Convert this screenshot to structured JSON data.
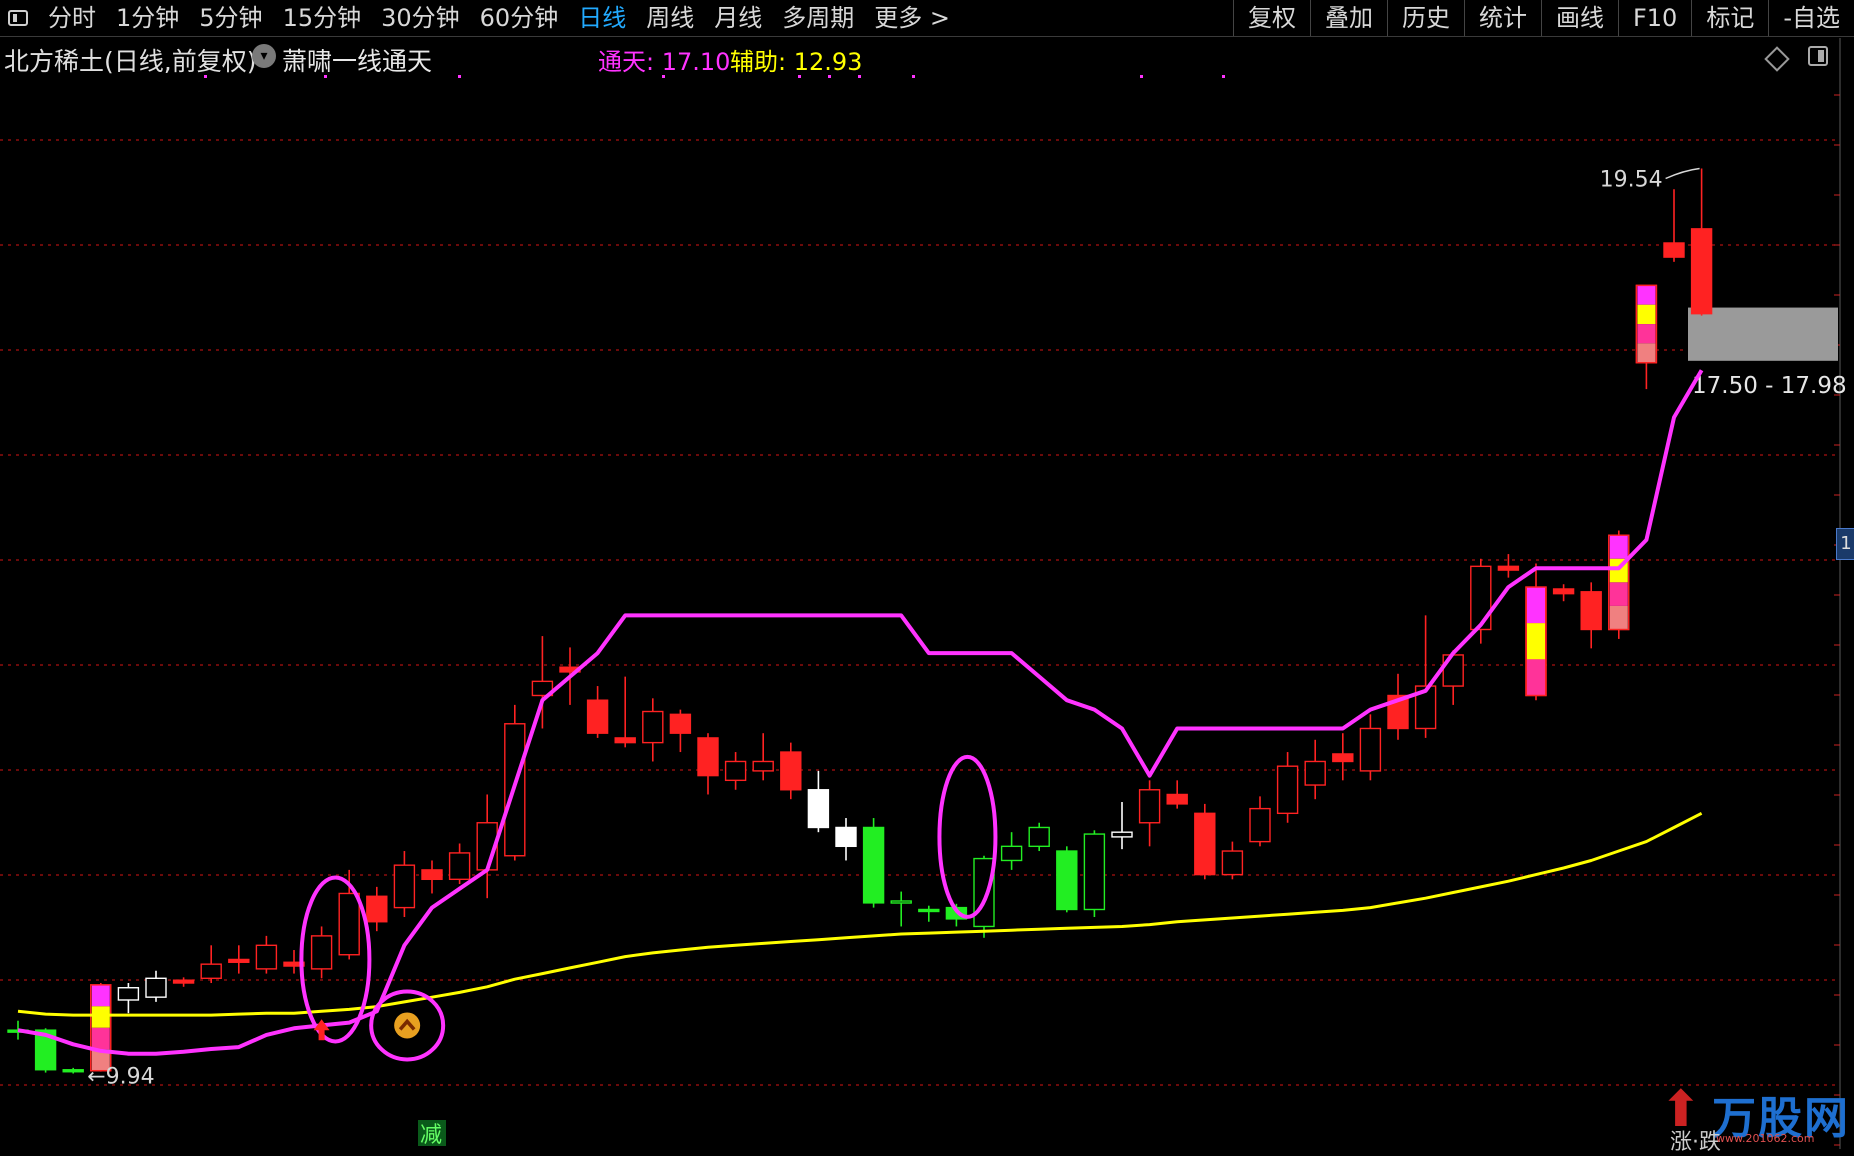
{
  "toolbar": {
    "periods": [
      "分时",
      "1分钟",
      "5分钟",
      "15分钟",
      "30分钟",
      "60分钟",
      "日线",
      "周线",
      "月线",
      "多周期",
      "更多 >"
    ],
    "active_index": 6,
    "right_buttons": [
      "复权",
      "叠加",
      "历史",
      "统计",
      "画线",
      "F10",
      "标记",
      "-自选"
    ]
  },
  "info": {
    "stock_title": "北方稀土(日线,前复权)",
    "indicator_name": "萧啸一线通天",
    "tongtian_label": "通天: 17.10",
    "fuzhu_label": "辅助: 12.93"
  },
  "side_tab": "1",
  "watermark": {
    "brand": "万股网",
    "url": "www.201062.com",
    "sub": "涨·跌"
  },
  "colors": {
    "up": "#ff2222",
    "down": "#22ee22",
    "tongtian": "#ff33ff",
    "fuzhu": "#ffff00",
    "grid": "#aa1111"
  },
  "chart_data": {
    "type": "candlestick",
    "price_range": [
      9.5,
      20.5
    ],
    "annotations": {
      "high_label": "19.54",
      "low_label": "9.94",
      "zone_label": "17.50 - 17.98",
      "sell_marker": "减"
    },
    "zone": [
      17.5,
      17.98
    ],
    "candles": [
      {
        "o": 10.4,
        "h": 10.5,
        "l": 10.3,
        "c": 10.4,
        "t": "d"
      },
      {
        "o": 10.4,
        "h": 10.42,
        "l": 9.95,
        "c": 9.98,
        "t": "d"
      },
      {
        "o": 9.98,
        "h": 10.0,
        "l": 9.94,
        "c": 9.97,
        "t": "d"
      },
      {
        "o": 9.97,
        "h": 10.9,
        "l": 9.96,
        "c": 10.88,
        "t": "u",
        "bars": true
      },
      {
        "o": 10.72,
        "h": 10.9,
        "l": 10.58,
        "c": 10.85,
        "t": "w"
      },
      {
        "o": 10.75,
        "h": 11.03,
        "l": 10.7,
        "c": 10.95,
        "t": "w"
      },
      {
        "o": 10.9,
        "h": 10.96,
        "l": 10.86,
        "c": 10.93,
        "t": "u",
        "filled": true
      },
      {
        "o": 10.95,
        "h": 11.3,
        "l": 10.9,
        "c": 11.1,
        "t": "u"
      },
      {
        "o": 11.12,
        "h": 11.3,
        "l": 11.0,
        "c": 11.15,
        "t": "u",
        "filled": true
      },
      {
        "o": 11.05,
        "h": 11.4,
        "l": 11.0,
        "c": 11.3,
        "t": "u"
      },
      {
        "o": 11.08,
        "h": 11.25,
        "l": 11.0,
        "c": 11.12,
        "t": "u",
        "filled": true
      },
      {
        "o": 11.05,
        "h": 11.5,
        "l": 10.95,
        "c": 11.4,
        "t": "u"
      },
      {
        "o": 11.2,
        "h": 12.1,
        "l": 11.15,
        "c": 11.85,
        "t": "u"
      },
      {
        "o": 11.82,
        "h": 11.92,
        "l": 11.45,
        "c": 11.55,
        "t": "u",
        "filled": true
      },
      {
        "o": 11.7,
        "h": 12.3,
        "l": 11.6,
        "c": 12.15,
        "t": "u"
      },
      {
        "o": 12.0,
        "h": 12.2,
        "l": 11.85,
        "c": 12.1,
        "t": "u",
        "filled": true
      },
      {
        "o": 12.0,
        "h": 12.38,
        "l": 11.95,
        "c": 12.28,
        "t": "u"
      },
      {
        "o": 12.1,
        "h": 12.9,
        "l": 11.8,
        "c": 12.6,
        "t": "u"
      },
      {
        "o": 12.25,
        "h": 13.85,
        "l": 12.2,
        "c": 13.65,
        "t": "u"
      },
      {
        "o": 13.95,
        "h": 14.58,
        "l": 13.6,
        "c": 14.1,
        "t": "u"
      },
      {
        "o": 14.25,
        "h": 14.46,
        "l": 13.85,
        "c": 14.2,
        "t": "u",
        "filled": true
      },
      {
        "o": 13.9,
        "h": 14.05,
        "l": 13.5,
        "c": 13.55,
        "t": "u",
        "filled": true
      },
      {
        "o": 13.5,
        "h": 14.15,
        "l": 13.4,
        "c": 13.45,
        "t": "u",
        "filled": true
      },
      {
        "o": 13.45,
        "h": 13.92,
        "l": 13.25,
        "c": 13.78,
        "t": "u"
      },
      {
        "o": 13.75,
        "h": 13.8,
        "l": 13.35,
        "c": 13.55,
        "t": "u",
        "filled": true
      },
      {
        "o": 13.5,
        "h": 13.55,
        "l": 12.9,
        "c": 13.1,
        "t": "u",
        "filled": true
      },
      {
        "o": 13.05,
        "h": 13.35,
        "l": 12.95,
        "c": 13.25,
        "t": "u"
      },
      {
        "o": 13.15,
        "h": 13.55,
        "l": 13.05,
        "c": 13.25,
        "t": "u"
      },
      {
        "o": 13.35,
        "h": 13.45,
        "l": 12.85,
        "c": 12.95,
        "t": "u",
        "filled": true
      },
      {
        "o": 12.95,
        "h": 13.15,
        "l": 12.5,
        "c": 12.55,
        "t": "w"
      },
      {
        "o": 12.55,
        "h": 12.65,
        "l": 12.2,
        "c": 12.35,
        "t": "w"
      },
      {
        "o": 12.55,
        "h": 12.65,
        "l": 11.7,
        "c": 11.75,
        "t": "d"
      },
      {
        "o": 11.77,
        "h": 11.87,
        "l": 11.5,
        "c": 11.75,
        "t": "d",
        "hollow": true
      },
      {
        "o": 11.68,
        "h": 11.72,
        "l": 11.55,
        "c": 11.66,
        "t": "d"
      },
      {
        "o": 11.7,
        "h": 11.74,
        "l": 11.5,
        "c": 11.58,
        "t": "d"
      },
      {
        "o": 11.5,
        "h": 12.25,
        "l": 11.38,
        "c": 12.22,
        "t": "d",
        "hollow": true
      },
      {
        "o": 12.2,
        "h": 12.5,
        "l": 12.1,
        "c": 12.35,
        "t": "d",
        "hollow": true
      },
      {
        "o": 12.35,
        "h": 12.6,
        "l": 12.3,
        "c": 12.55,
        "t": "d",
        "hollow": true
      },
      {
        "o": 12.3,
        "h": 12.35,
        "l": 11.65,
        "c": 11.68,
        "t": "d"
      },
      {
        "o": 11.68,
        "h": 12.52,
        "l": 11.6,
        "c": 12.48,
        "t": "d",
        "hollow": true
      },
      {
        "o": 12.45,
        "h": 12.82,
        "l": 12.32,
        "c": 12.5,
        "t": "w"
      },
      {
        "o": 12.6,
        "h": 13.05,
        "l": 12.35,
        "c": 12.95,
        "t": "u"
      },
      {
        "o": 12.9,
        "h": 13.05,
        "l": 12.75,
        "c": 12.8,
        "t": "u",
        "filled": true
      },
      {
        "o": 12.7,
        "h": 12.8,
        "l": 12.0,
        "c": 12.05,
        "t": "u",
        "filled": true
      },
      {
        "o": 12.05,
        "h": 12.4,
        "l": 12.0,
        "c": 12.3,
        "t": "u"
      },
      {
        "o": 12.4,
        "h": 12.88,
        "l": 12.35,
        "c": 12.75,
        "t": "u"
      },
      {
        "o": 12.7,
        "h": 13.35,
        "l": 12.6,
        "c": 13.2,
        "t": "u"
      },
      {
        "o": 13.0,
        "h": 13.48,
        "l": 12.85,
        "c": 13.25,
        "t": "u"
      },
      {
        "o": 13.33,
        "h": 13.55,
        "l": 13.05,
        "c": 13.25,
        "t": "u",
        "filled": true
      },
      {
        "o": 13.15,
        "h": 13.75,
        "l": 13.05,
        "c": 13.6,
        "t": "u"
      },
      {
        "o": 13.95,
        "h": 14.18,
        "l": 13.48,
        "c": 13.6,
        "t": "u",
        "filled": true
      },
      {
        "o": 13.6,
        "h": 14.8,
        "l": 13.5,
        "c": 14.05,
        "t": "u"
      },
      {
        "o": 14.05,
        "h": 14.43,
        "l": 13.85,
        "c": 14.38,
        "t": "u"
      },
      {
        "o": 14.65,
        "h": 15.4,
        "l": 14.5,
        "c": 15.32,
        "t": "u"
      },
      {
        "o": 15.32,
        "h": 15.45,
        "l": 15.2,
        "c": 15.28,
        "t": "u",
        "filled": true
      },
      {
        "o": 15.1,
        "h": 15.35,
        "l": 13.9,
        "c": 13.95,
        "t": "u",
        "filled": true,
        "bars": "half"
      },
      {
        "o": 15.08,
        "h": 15.13,
        "l": 14.95,
        "c": 15.03,
        "t": "u",
        "filled": true
      },
      {
        "o": 14.65,
        "h": 15.15,
        "l": 14.45,
        "c": 15.05,
        "t": "u",
        "filled": true
      },
      {
        "o": 14.65,
        "h": 15.7,
        "l": 14.55,
        "c": 15.65,
        "t": "u",
        "bars": true
      },
      {
        "o": 17.48,
        "h": 18.3,
        "l": 17.2,
        "c": 18.3,
        "t": "u",
        "bars": true
      },
      {
        "o": 18.6,
        "h": 19.32,
        "l": 18.55,
        "c": 18.75,
        "t": "u",
        "filled": true
      },
      {
        "o": 18.0,
        "h": 19.54,
        "l": 17.98,
        "c": 18.9,
        "t": "u",
        "filled": true
      }
    ],
    "tongtian": [
      10.4,
      10.35,
      10.25,
      10.18,
      10.15,
      10.15,
      10.17,
      10.2,
      10.22,
      10.35,
      10.42,
      10.45,
      10.48,
      10.6,
      11.3,
      11.7,
      11.9,
      12.1,
      13.0,
      13.9,
      14.15,
      14.4,
      14.8,
      14.8,
      14.8,
      14.8,
      14.8,
      14.8,
      14.8,
      14.8,
      14.8,
      14.8,
      14.8,
      14.4,
      14.4,
      14.4,
      14.4,
      14.15,
      13.9,
      13.8,
      13.6,
      13.1,
      13.6,
      13.6,
      13.6,
      13.6,
      13.6,
      13.6,
      13.6,
      13.8,
      13.9,
      14.0,
      14.4,
      14.7,
      15.1,
      15.3,
      15.3,
      15.3,
      15.3,
      15.6,
      16.9,
      17.4
    ],
    "fuzhu": [
      10.6,
      10.57,
      10.56,
      10.56,
      10.56,
      10.56,
      10.56,
      10.56,
      10.57,
      10.58,
      10.58,
      10.6,
      10.62,
      10.65,
      10.7,
      10.75,
      10.8,
      10.86,
      10.94,
      11.0,
      11.06,
      11.12,
      11.18,
      11.22,
      11.25,
      11.28,
      11.3,
      11.32,
      11.34,
      11.36,
      11.38,
      11.4,
      11.42,
      11.43,
      11.44,
      11.45,
      11.46,
      11.47,
      11.48,
      11.49,
      11.5,
      11.52,
      11.55,
      11.57,
      11.59,
      11.61,
      11.63,
      11.65,
      11.67,
      11.7,
      11.75,
      11.8,
      11.86,
      11.92,
      11.98,
      12.05,
      12.12,
      12.2,
      12.3,
      12.4,
      12.55,
      12.7
    ]
  }
}
